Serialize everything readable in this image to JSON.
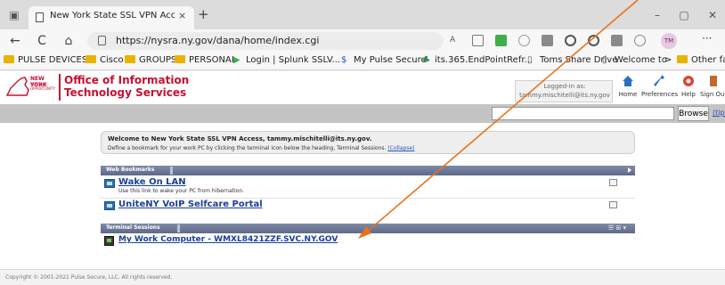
{
  "browser": {
    "tab_title": "New York State SSL VPN Access",
    "tab_close": "×",
    "new_tab": "+",
    "url": "https://nysra.ny.gov/dana/home/index.cgi",
    "profile_initials": "TM",
    "more_menu": "···",
    "window_buttons": {
      "minimize": "–",
      "restore": "▢",
      "close": "✕"
    },
    "nav": {
      "back": "←",
      "reload": "C",
      "home": "⌂"
    },
    "bookmarks": [
      {
        "label": "PULSE DEVICES",
        "icon": "folder-icon"
      },
      {
        "label": "Cisco",
        "icon": "folder-icon"
      },
      {
        "label": "GROUPS",
        "icon": "folder-icon"
      },
      {
        "label": "PERSONAL",
        "icon": "folder-icon"
      },
      {
        "label": "Login | Splunk SSLV...",
        "icon": "splunk-icon"
      },
      {
        "label": "My Pulse Secure",
        "icon": "pulse-icon"
      },
      {
        "label": "its.365.EndPointRefr...",
        "icon": "app-icon"
      },
      {
        "label": "Toms Share Drive",
        "icon": "page-icon"
      },
      {
        "label": "Welcome to My NY....",
        "icon": "page-icon"
      }
    ],
    "bookmarks_overflow": ">",
    "other_favorites": "Other favorites"
  },
  "header": {
    "state_name": "NEW YORK",
    "state_sub": "STATE OF\nOPPORTUNITY",
    "office_line1": "Office of Information",
    "office_line2": "Technology Services",
    "logged_in_label": "Logged-in as:",
    "logged_in_user": "tammy.mischitelli@its.ny.gov",
    "buttons": {
      "home": "Home",
      "preferences": "Preferences",
      "help": "Help",
      "sign_out": "Sign Out"
    }
  },
  "toolbar": {
    "browse_label": "Browse",
    "tips_label": "(tips)"
  },
  "welcome": {
    "line1": "Welcome to New York State SSL VPN Access, tammy.mischitelli@its.ny.gov.",
    "line2": "Define a bookmark for your work PC by clicking the terminal icon below the heading, Terminal Sessions.",
    "collapse": "(Collapse)"
  },
  "web_bookmarks": {
    "title": "Web Bookmarks",
    "items": [
      {
        "title": "Wake On LAN",
        "description": "Use this link to wake your PC from hibernation."
      },
      {
        "title": "UniteNY VoIP Selfcare Portal",
        "description": ""
      }
    ]
  },
  "terminal_sessions": {
    "title": "Terminal Sessions",
    "items": [
      {
        "title": "My Work Computer - WMXL8421ZZF.SVC.NY.GOV"
      }
    ]
  },
  "footer": {
    "copyright": "Copyright © 2001-2021 Pulse Secure, LLC. All rights reserved."
  },
  "colors": {
    "brand_red": "#c8102e",
    "link_blue": "#1a3e99",
    "section_bar": "#6a7694",
    "annotation_arrow": "#e8731c"
  }
}
